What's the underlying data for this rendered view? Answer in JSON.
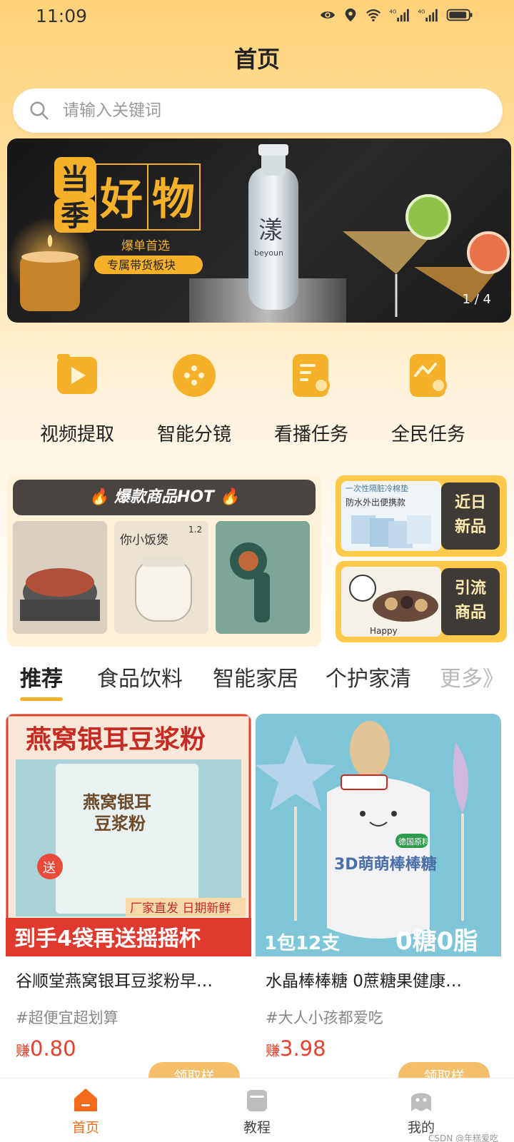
{
  "status_bar": {
    "time": "11:09",
    "icons": [
      "eye-icon",
      "location-icon",
      "wifi-icon",
      "signal-4g-icon",
      "signal-4g-icon",
      "battery-icon"
    ],
    "network_labels": [
      "4G",
      "4G"
    ]
  },
  "header": {
    "title": "首页"
  },
  "search": {
    "placeholder": "请输入关键词"
  },
  "banner": {
    "title_chars": [
      "当",
      "季",
      "好",
      "物"
    ],
    "subtitle": "爆单首选",
    "badge": "专属带货板块",
    "bottle_brand": "漾",
    "bottle_sub": "beyoun",
    "indicator": "1 / 4"
  },
  "quick_menu": [
    {
      "label": "视频提取",
      "icon": "video-icon"
    },
    {
      "label": "智能分镜",
      "icon": "storyboard-icon"
    },
    {
      "label": "看播任务",
      "icon": "task-search-icon"
    },
    {
      "label": "全民任务",
      "icon": "task-chart-icon"
    }
  ],
  "promo": {
    "hot_title": "爆款商品HOT",
    "hot_items_text": [
      "你小饭煲",
      "1.2"
    ],
    "side_cards": [
      {
        "label": "近日\n新品",
        "thumb_text": "防水外出便携款",
        "thumb_banner": "一次性隔脏冷棉垫"
      },
      {
        "label": "引流\n商品",
        "thumb_text": "Happy"
      }
    ]
  },
  "tabs": [
    {
      "label": "推荐",
      "active": true
    },
    {
      "label": "食品饮料",
      "active": false
    },
    {
      "label": "智能家居",
      "active": false
    },
    {
      "label": "个护家清",
      "active": false
    },
    {
      "label": "更多》",
      "active": false
    }
  ],
  "products": [
    {
      "img_headline": "燕窝银耳豆浆粉",
      "img_pack": "燕窝银耳\n豆浆粉",
      "img_gift": "送",
      "img_note": "厂家直发 日期新鲜",
      "img_bottom": "到手4袋再送摇摇杯",
      "title": "谷顺堂燕窝银耳豆浆粉早…",
      "tag": "#超便宜超划算",
      "earn_label": "赚",
      "earn_value": "0.80",
      "button": "领取样",
      "color": "#E8402A"
    },
    {
      "img_pack": "3D萌萌棒棒糖",
      "img_brand": "德国原料",
      "img_bottom_left": "1包12支",
      "img_bottom_right": "0糖0脂",
      "title": "水晶棒棒糖 0蔗糖果健康…",
      "tag": "#大人小孩都爱吃",
      "earn_label": "赚",
      "earn_value": "3.98",
      "button": "领取样",
      "color": "#E8402A"
    }
  ],
  "bottom_nav": [
    {
      "label": "首页",
      "icon": "home-icon",
      "active": true
    },
    {
      "label": "教程",
      "icon": "tutorial-icon",
      "active": false
    },
    {
      "label": "我的",
      "icon": "profile-icon",
      "active": false
    }
  ],
  "watermark": "CSDN @年糕爱吃",
  "colors": {
    "accent": "#F5B12A",
    "price": "#E8402A",
    "nav_active": "#F36A1B"
  }
}
